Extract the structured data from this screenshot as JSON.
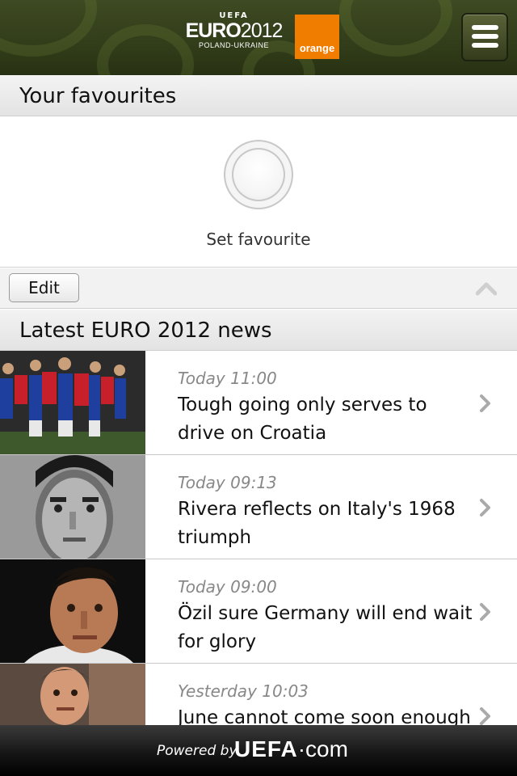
{
  "header": {
    "logo_top": "UEFA",
    "logo_main": "EURO",
    "logo_year": "2012",
    "logo_sub": "POLAND-UKRAINE",
    "sponsor": "orange",
    "menu_icon": "hamburger-menu-icon",
    "colors": {
      "header_bg": "#2f3a18",
      "sponsor_bg": "#f07c00"
    }
  },
  "favourites": {
    "heading": "Your favourites",
    "set_label": "Set favourite",
    "edit_label": "Edit",
    "collapse_icon": "chevron-up-icon"
  },
  "news": {
    "heading": "Latest EURO 2012 news",
    "items": [
      {
        "time": "Today 11:00",
        "title": "Tough going only serves to drive on Croatia",
        "image": "croatia-team-celebration-photo"
      },
      {
        "time": "Today 09:13",
        "title": "Rivera reflects on Italy's 1968 triumph",
        "image": "rivera-portrait-photo"
      },
      {
        "time": "Today 09:00",
        "title": "Özil sure Germany will end wait for glory",
        "image": "ozil-portrait-photo"
      },
      {
        "time": "Yesterday 10:03",
        "title": "June cannot come soon enough",
        "image": "player-portrait-photo"
      }
    ]
  },
  "footer": {
    "powered_by": "Powered by",
    "brand": "UEFA",
    "brand_suffix": "·com"
  }
}
